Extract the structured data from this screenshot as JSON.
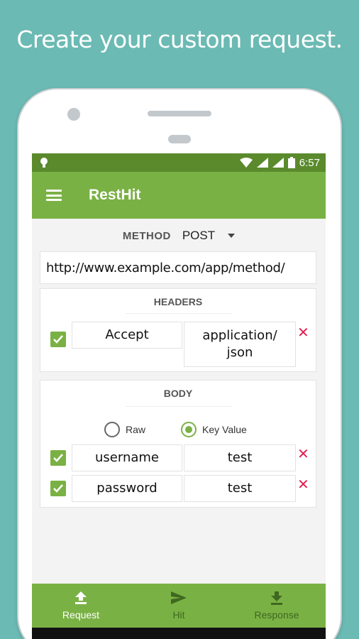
{
  "promo": {
    "headline": "Create your custom request."
  },
  "status": {
    "time": "6:57"
  },
  "app": {
    "title": "RestHit"
  },
  "method": {
    "label": "METHOD",
    "value": "POST"
  },
  "url": {
    "value": "http://www.example.com/app/method/"
  },
  "headers": {
    "title": "HEADERS",
    "rows": [
      {
        "key": "Accept",
        "value_line1": "application/",
        "value_line2": "json",
        "checked": true
      }
    ]
  },
  "body": {
    "title": "BODY",
    "modes": [
      {
        "label": "Raw",
        "selected": false
      },
      {
        "label": "Key Value",
        "selected": true
      }
    ],
    "rows": [
      {
        "key": "username",
        "value": "test",
        "checked": true
      },
      {
        "key": "password",
        "value": "test",
        "checked": true
      }
    ]
  },
  "nav": {
    "items": [
      {
        "label": "Request",
        "icon": "upload-icon",
        "active": true
      },
      {
        "label": "Hit",
        "icon": "send-icon",
        "active": false
      },
      {
        "label": "Response",
        "icon": "download-icon",
        "active": false
      }
    ]
  },
  "colors": {
    "primary": "#7ab144",
    "primary_dark": "#5a8a2c",
    "accent_delete": "#e02050",
    "background": "#6cbab4"
  }
}
